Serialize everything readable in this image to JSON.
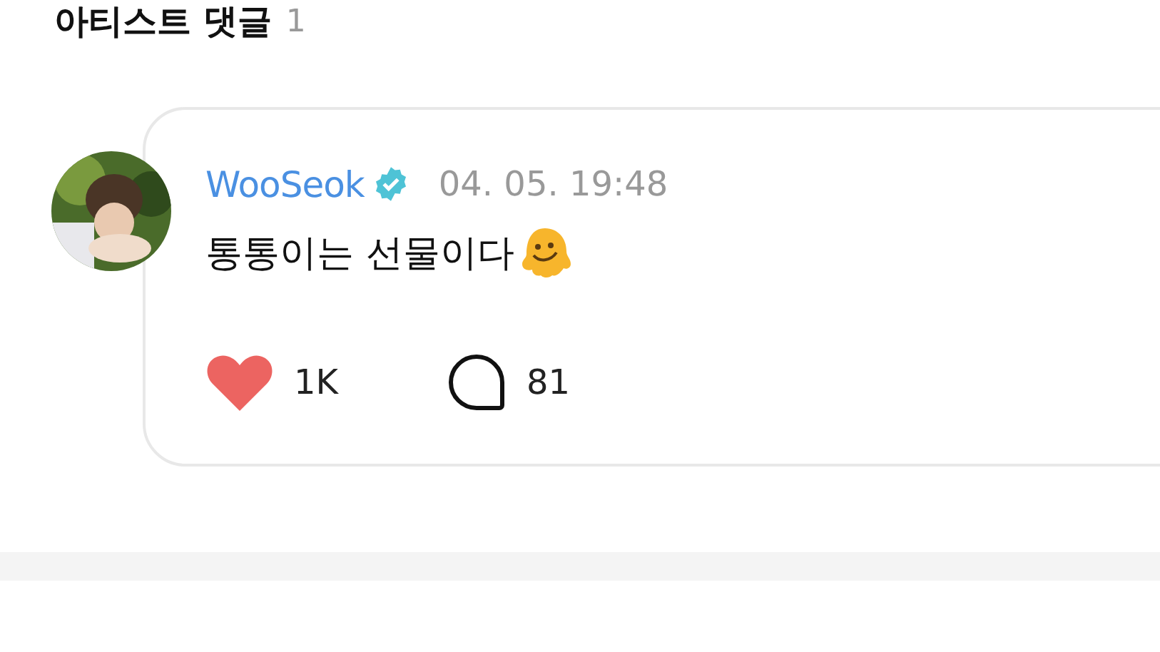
{
  "section": {
    "title": "아티스트 댓글",
    "count": "1"
  },
  "comment": {
    "author": "WooSeok",
    "verified": true,
    "time": "04. 05. 19:48",
    "text": "통통이는 선물이다",
    "liked": true,
    "likes": "1K",
    "replies": "81"
  }
}
